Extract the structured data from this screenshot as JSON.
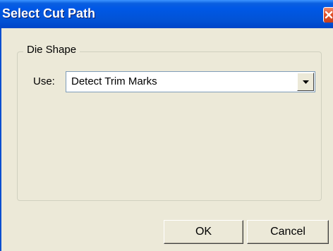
{
  "dialog": {
    "title": "Select Cut Path"
  },
  "icons": {
    "close": "close-icon",
    "dropdown": "chevron-down-icon"
  },
  "group": {
    "legend": "Die Shape",
    "use_label": "Use:",
    "use_value": "Detect Trim Marks"
  },
  "buttons": {
    "ok_label": "OK",
    "cancel_label": "Cancel"
  },
  "colors": {
    "titlebar": "#0058e6",
    "face": "#ece9d8",
    "close": "#e0522a"
  }
}
